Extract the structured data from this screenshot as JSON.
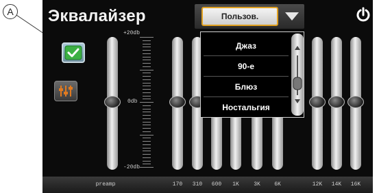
{
  "callout": {
    "label": "A"
  },
  "header": {
    "title": "Эквалайзер",
    "preset_button_label": "Пользов."
  },
  "scale": {
    "top_label": "+20db",
    "mid_label": "0db",
    "bottom_label": "-20db"
  },
  "dropdown": {
    "items": [
      "Джаз",
      "90-е",
      "Блюз",
      "Ностальгия"
    ]
  },
  "footer": {
    "preamp_label": "preamp",
    "frequencies": [
      "170",
      "310",
      "600",
      "1K",
      "3K",
      "6K",
      "12K",
      "14K",
      "16K"
    ]
  },
  "levels_db": {
    "preamp": 0,
    "bands": [
      0,
      0,
      0,
      0,
      0,
      0,
      0,
      0,
      0
    ]
  },
  "colors": {
    "accent_border": "#e0a020",
    "check_green": "#3cb043",
    "eq_icon_orange": "#e07a20"
  },
  "icons": {
    "check": "check-icon",
    "eq": "equalizer-icon",
    "power": "power-icon",
    "dropdown": "triangle-down-icon",
    "scroll_up": "arrow-up-icon",
    "scroll_down": "arrow-down-icon"
  }
}
